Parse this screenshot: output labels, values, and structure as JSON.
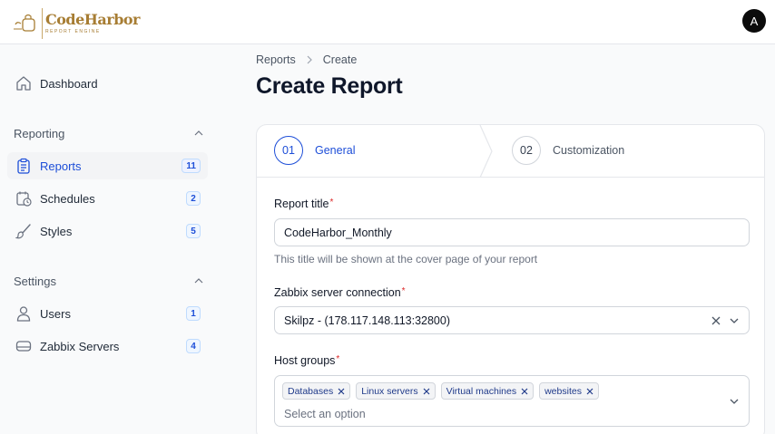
{
  "brand": {
    "name": "CodeHarbor",
    "tagline": "REPORT ENGINE",
    "color": "#a77d33"
  },
  "user": {
    "avatar_initial": "A"
  },
  "sidebar": {
    "dashboard": {
      "label": "Dashboard",
      "icon": "home-icon"
    },
    "reporting": {
      "title": "Reporting",
      "items": [
        {
          "label": "Reports",
          "count": "11",
          "icon": "clipboard-icon",
          "active": true
        },
        {
          "label": "Schedules",
          "count": "2",
          "icon": "calendar-clock-icon"
        },
        {
          "label": "Styles",
          "count": "5",
          "icon": "brush-icon"
        }
      ]
    },
    "settings": {
      "title": "Settings",
      "items": [
        {
          "label": "Users",
          "count": "1",
          "icon": "user-icon"
        },
        {
          "label": "Zabbix Servers",
          "count": "4",
          "icon": "server-icon"
        }
      ]
    }
  },
  "breadcrumb": {
    "parent": "Reports",
    "current": "Create"
  },
  "page": {
    "title": "Create Report"
  },
  "steps": [
    {
      "number": "01",
      "label": "General",
      "active": true
    },
    {
      "number": "02",
      "label": "Customization"
    }
  ],
  "form": {
    "report_title": {
      "label": "Report title",
      "value": "CodeHarbor_Monthly",
      "hint": "This title will be shown at the cover page of your report"
    },
    "server": {
      "label": "Zabbix server connection",
      "value": "Skilpz - (178.117.148.113:32800)"
    },
    "host_groups": {
      "label": "Host groups",
      "tags": [
        "Databases",
        "Linux servers",
        "Virtual machines",
        "websites"
      ],
      "placeholder": "Select an option"
    }
  },
  "colors": {
    "accent": "#1d4ed8",
    "required": "#dc2626"
  }
}
